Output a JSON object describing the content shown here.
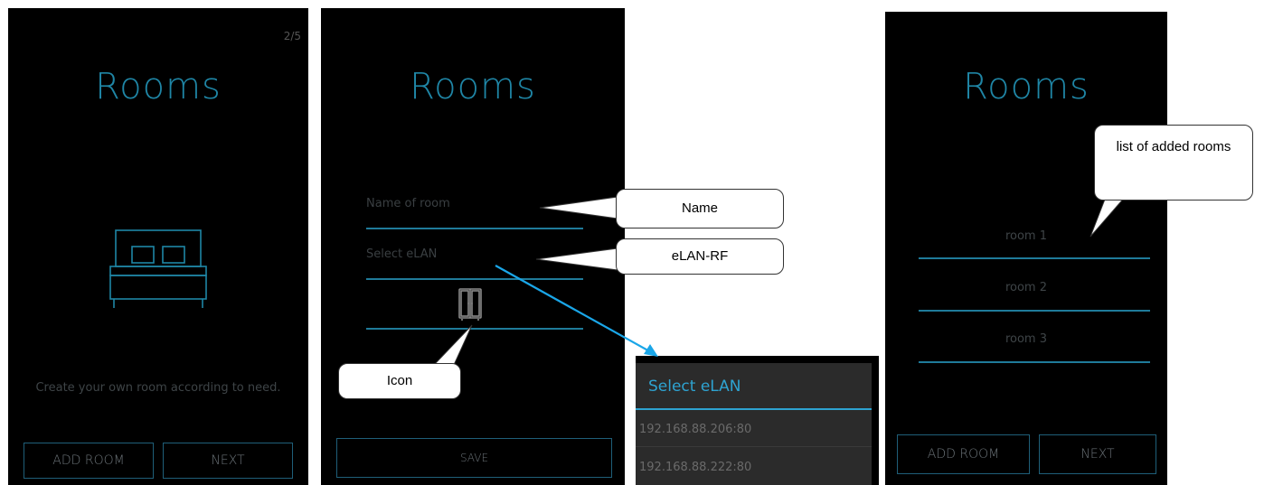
{
  "screen1": {
    "page_indicator": "2/5",
    "title": "Rooms",
    "description": "Create your own room according to need.",
    "add_room_label": "ADD ROOM",
    "next_label": "NEXT",
    "illustration_icon": "bed-icon"
  },
  "screen2": {
    "title": "Rooms",
    "name_placeholder": "Name of room",
    "select_elan_placeholder": "Select eLAN",
    "room_icon": "wardrobe-icon",
    "save_label": "SAVE"
  },
  "callouts": {
    "name": "Name",
    "elan": "eLAN-RF",
    "icon": "Icon",
    "rooms_list": "list of added rooms"
  },
  "dropdown": {
    "title": "Select eLAN",
    "items": [
      "192.168.88.206:80",
      "192.168.88.222:80"
    ]
  },
  "screen3": {
    "title": "Rooms",
    "rooms": [
      "room 1",
      "room 2",
      "room 3"
    ],
    "add_room_label": "ADD ROOM",
    "next_label": "NEXT"
  },
  "colors": {
    "accent": "#1f86a6",
    "line": "#1f7b9a",
    "arrow": "#1aa6e8",
    "dropdown_accent": "#2ea3d1"
  }
}
